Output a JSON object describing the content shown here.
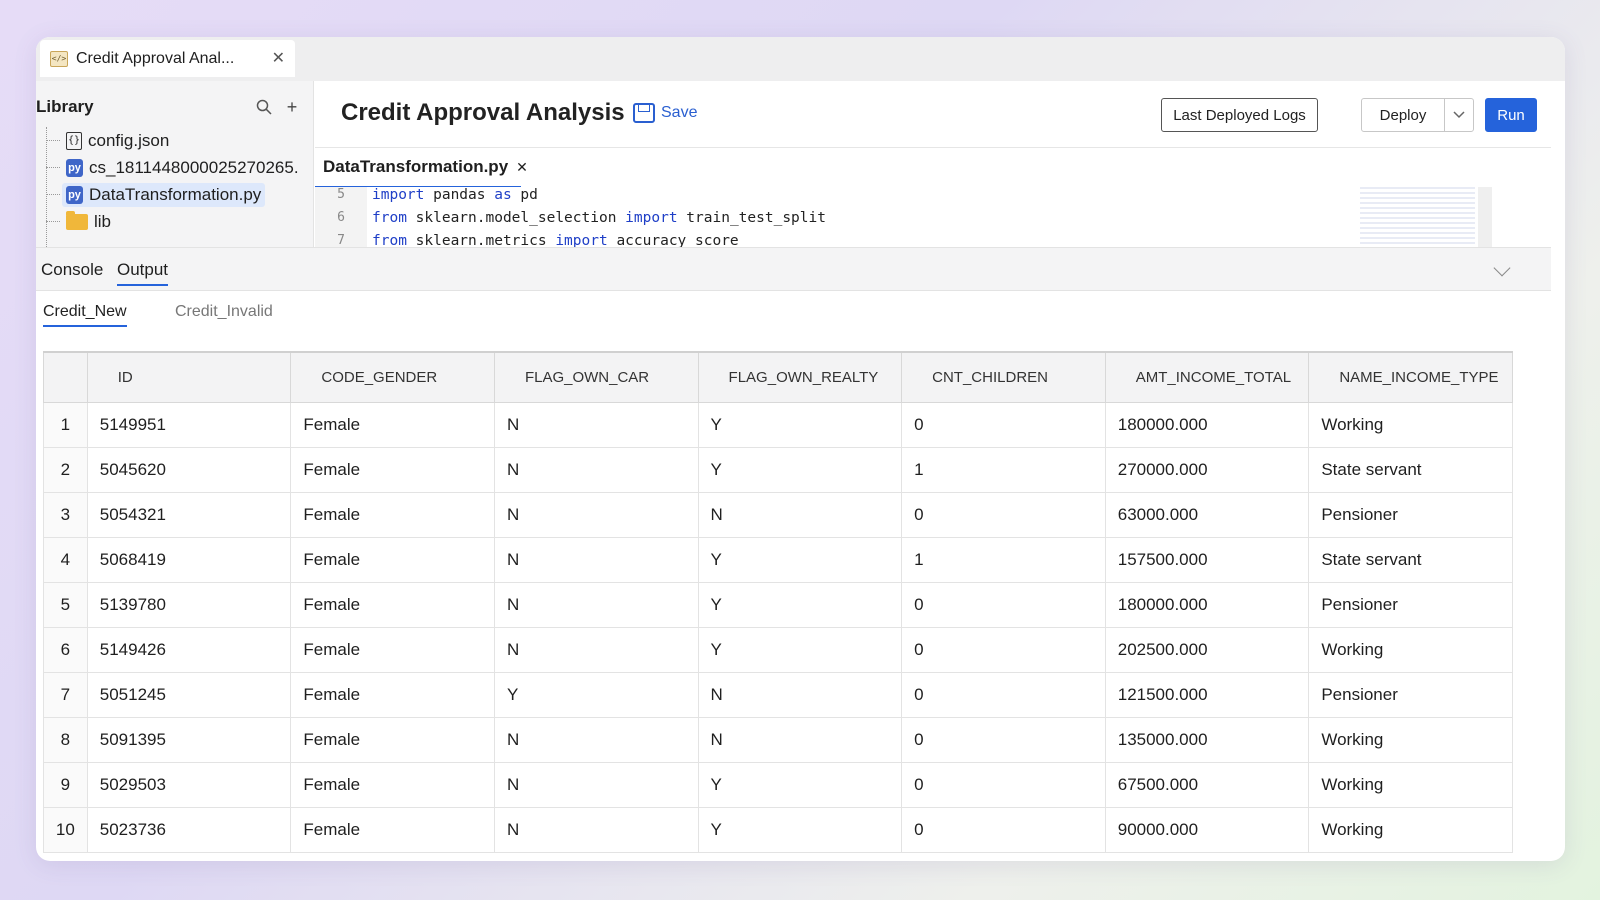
{
  "window_tab": {
    "title": "Credit Approval Anal...",
    "icon": "code-file-icon"
  },
  "library": {
    "title": "Library",
    "items": [
      {
        "label": "config.json",
        "icon": "json-file-icon"
      },
      {
        "label": "cs_1811448000025270265.",
        "icon": "python-file-icon"
      },
      {
        "label": "DataTransformation.py",
        "icon": "python-file-icon",
        "selected": true
      },
      {
        "label": "lib",
        "icon": "folder-icon"
      }
    ]
  },
  "header": {
    "title": "Credit Approval Analysis",
    "save_label": "Save",
    "logs_label": "Last Deployed Logs",
    "deploy_label": "Deploy",
    "run_label": "Run"
  },
  "editor": {
    "tab_label": "DataTransformation.py",
    "lines": [
      {
        "n": "5",
        "parts": [
          [
            "import",
            "kw"
          ],
          [
            " pandas ",
            ""
          ],
          [
            "as",
            "kw"
          ],
          [
            " pd",
            ""
          ]
        ]
      },
      {
        "n": "6",
        "parts": [
          [
            "from",
            "kw"
          ],
          [
            " sklearn.model_selection ",
            ""
          ],
          [
            "import",
            "kw"
          ],
          [
            " train_test_split",
            ""
          ]
        ]
      },
      {
        "n": "7",
        "parts": [
          [
            "from",
            "kw"
          ],
          [
            " sklearn.metrics ",
            ""
          ],
          [
            "import",
            "kw"
          ],
          [
            " accuracy_score",
            ""
          ]
        ]
      }
    ]
  },
  "console": {
    "tabs": [
      "Console",
      "Output"
    ],
    "active": "Output"
  },
  "output": {
    "subtabs": [
      "Credit_New",
      "Credit_Invalid"
    ],
    "active": "Credit_New"
  },
  "table": {
    "columns": [
      "ID",
      "CODE_GENDER",
      "FLAG_OWN_CAR",
      "FLAG_OWN_REALTY",
      "CNT_CHILDREN",
      "AMT_INCOME_TOTAL",
      "NAME_INCOME_TYPE"
    ],
    "rows": [
      [
        "1",
        "5149951",
        "Female",
        "N",
        "Y",
        "0",
        "180000.000",
        "Working"
      ],
      [
        "2",
        "5045620",
        "Female",
        "N",
        "Y",
        "1",
        "270000.000",
        "State servant"
      ],
      [
        "3",
        "5054321",
        "Female",
        "N",
        "N",
        "0",
        "63000.000",
        "Pensioner"
      ],
      [
        "4",
        "5068419",
        "Female",
        "N",
        "Y",
        "1",
        "157500.000",
        "State servant"
      ],
      [
        "5",
        "5139780",
        "Female",
        "N",
        "Y",
        "0",
        "180000.000",
        "Pensioner"
      ],
      [
        "6",
        "5149426",
        "Female",
        "N",
        "Y",
        "0",
        "202500.000",
        "Working"
      ],
      [
        "7",
        "5051245",
        "Female",
        "Y",
        "N",
        "0",
        "121500.000",
        "Pensioner"
      ],
      [
        "8",
        "5091395",
        "Female",
        "N",
        "N",
        "0",
        "135000.000",
        "Working"
      ],
      [
        "9",
        "5029503",
        "Female",
        "N",
        "Y",
        "0",
        "67500.000",
        "Working"
      ],
      [
        "10",
        "5023736",
        "Female",
        "N",
        "Y",
        "0",
        "90000.000",
        "Working"
      ]
    ]
  },
  "colors": {
    "accent": "#2563db"
  }
}
